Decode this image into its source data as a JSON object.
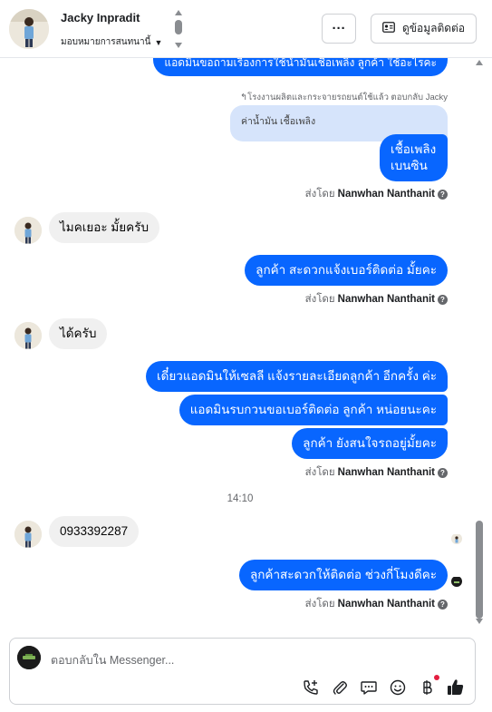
{
  "header": {
    "contact_name": "Jacky Inpradit",
    "assign_label": "มอบหมายการสนทนานี้",
    "more_label": "···",
    "contact_info_label": "ดูข้อมูลติดต่อ"
  },
  "messages": {
    "top_cut_text": "แอดมินขอถามเรื่องการใช้น้ำมันเชื้อเพลิง ลูกค้า ใช้อะไรคะ",
    "reply_note": "↰โรงงานผลิตและกระจายรถยนต์ใช้แล้ว ตอบกลับ Jacky",
    "quoted_text": "ค่าน้ำมัน เชื้อเพลิง",
    "fuel_line1": "เชื้อเพลิง",
    "fuel_line2": "เบนซิน",
    "sent_by_prefix": "ส่งโดย",
    "sender": "Nanwhan Nanthanit",
    "in_1": "ไมคเยอะ มั้ยครับ",
    "out_2": "ลูกค้า สะดวกแจ้งเบอร์ติดต่อ มั้ยคะ",
    "in_2": "ได้ครับ",
    "out_3a": "เดี๋ยวแอดมินให้เซลลี แจ้งรายละเอียดลูกค้า อีกครั้ง ค่ะ",
    "out_3b": "แอดมินรบกวนขอเบอร์ติดต่อ ลูกค้า หน่อยนะคะ",
    "out_3c": "ลูกค้า ยังสนใจรถอยู่มั้ยคะ",
    "timestamp": "14:10",
    "in_3": "0933392287",
    "out_4": "ลูกค้าสะดวกให้ติดต่อ ช่วงกี่โมงดีคะ"
  },
  "composer": {
    "placeholder": "ตอบกลับใน Messenger..."
  },
  "icons": [
    "chevron-down-icon",
    "more-icon",
    "contact-card-icon",
    "info-icon",
    "add-call-icon",
    "attachment-icon",
    "saved-reply-icon",
    "emoji-icon",
    "baht-icon",
    "like-icon"
  ],
  "colors": {
    "outgoing_bubble": "#0866ff",
    "incoming_bubble": "#f0f0f0",
    "quoted_bubble": "#d6e4fb",
    "notification_dot": "#e41e3f"
  }
}
